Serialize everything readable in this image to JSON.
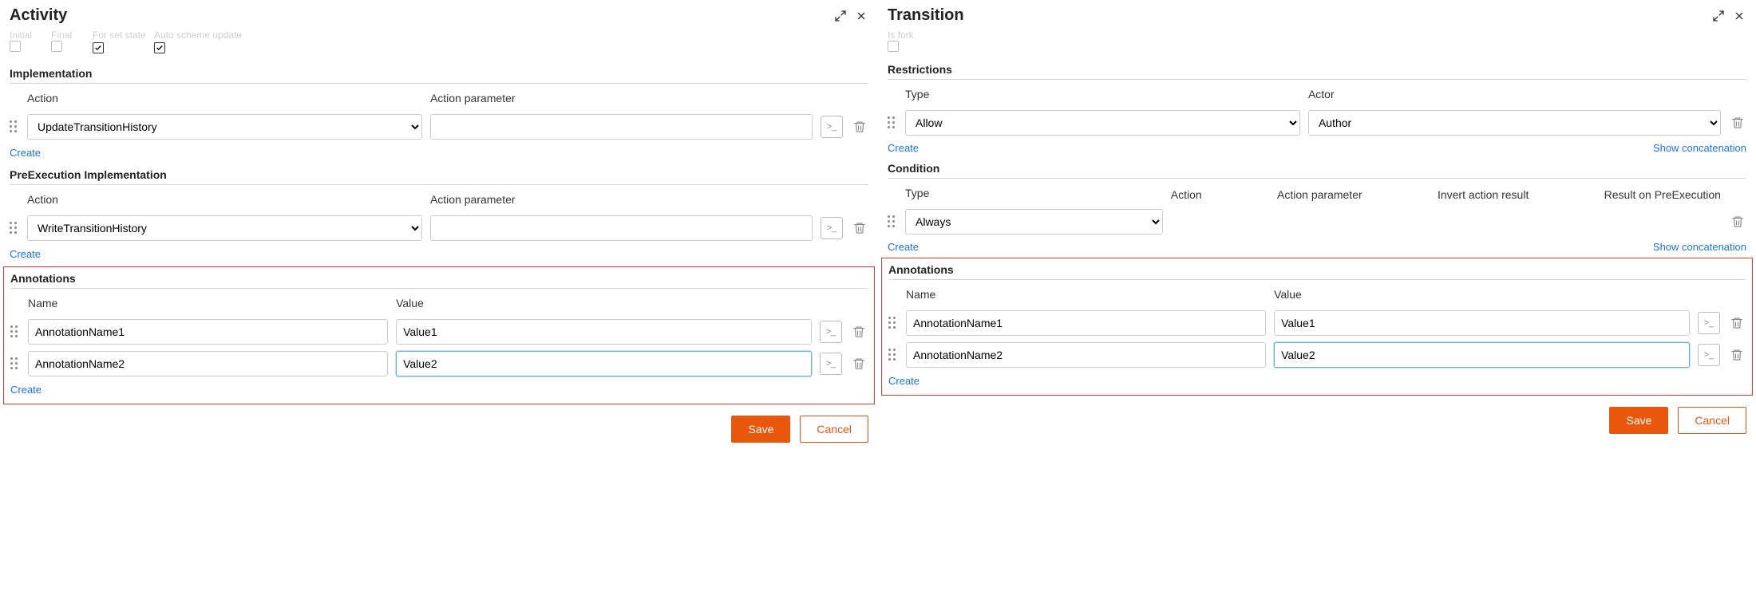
{
  "activity": {
    "title": "Activity",
    "flags": {
      "labels": [
        "Initial",
        "Final",
        "For set state",
        "Auto scheme update"
      ],
      "values": [
        false,
        false,
        true,
        true
      ]
    },
    "implementation": {
      "title": "Implementation",
      "action_label": "Action",
      "param_label": "Action parameter",
      "action_value": "UpdateTransitionHistory",
      "create": "Create"
    },
    "preexec": {
      "title": "PreExecution Implementation",
      "action_label": "Action",
      "param_label": "Action parameter",
      "action_value": "WriteTransitionHistory",
      "create": "Create"
    },
    "annotations": {
      "title": "Annotations",
      "name_label": "Name",
      "value_label": "Value",
      "rows": [
        {
          "name": "AnnotationName1",
          "value": "Value1"
        },
        {
          "name": "AnnotationName2",
          "value": "Value2"
        }
      ],
      "create": "Create"
    },
    "save": "Save",
    "cancel": "Cancel"
  },
  "transition": {
    "title": "Transition",
    "isfork_label": "Is fork",
    "restrictions": {
      "title": "Restrictions",
      "type_label": "Type",
      "actor_label": "Actor",
      "type_value": "Allow",
      "actor_value": "Author",
      "create": "Create",
      "show_concat": "Show concatenation"
    },
    "condition": {
      "title": "Condition",
      "headers": [
        "Type",
        "Action",
        "Action parameter",
        "Invert action result",
        "Result on PreExecution"
      ],
      "type_value": "Always",
      "create": "Create",
      "show_concat": "Show concatenation"
    },
    "annotations": {
      "title": "Annotations",
      "name_label": "Name",
      "value_label": "Value",
      "rows": [
        {
          "name": "AnnotationName1",
          "value": "Value1"
        },
        {
          "name": "AnnotationName2",
          "value": "Value2"
        }
      ],
      "create": "Create"
    },
    "save": "Save",
    "cancel": "Cancel"
  }
}
